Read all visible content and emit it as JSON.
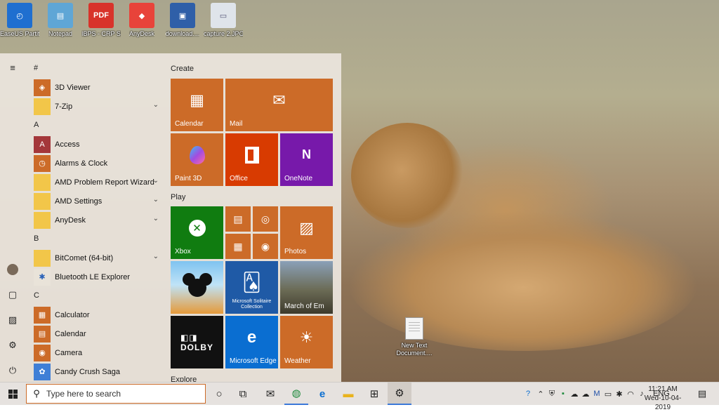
{
  "desktop": {
    "icons": [
      {
        "label": "EaseUS Partition ...",
        "color": "#1f6fd0",
        "glyph": "◴"
      },
      {
        "label": "Notepad",
        "color": "#5fa6d6",
        "glyph": "▤"
      },
      {
        "label": "IBPS - CRP SPL-VIII - R...",
        "color": "#d8332a",
        "glyph": "PDF"
      },
      {
        "label": "AnyDesk",
        "color": "#e8433a",
        "glyph": "◆"
      },
      {
        "label": "download....",
        "color": "#2f5fa8",
        "glyph": "▣"
      },
      {
        "label": "capture 2.JPG",
        "color": "#dfe4ea",
        "glyph": "▭"
      }
    ],
    "new_text_label": "New Text Document...."
  },
  "start_menu": {
    "rail": [
      {
        "name": "hamburger-menu-icon",
        "glyph": "≡"
      },
      {
        "name": "user-avatar-icon",
        "glyph": "●"
      },
      {
        "name": "documents-icon",
        "glyph": "▢"
      },
      {
        "name": "pictures-icon",
        "glyph": "▨"
      },
      {
        "name": "settings-icon",
        "glyph": "⚙"
      },
      {
        "name": "power-icon",
        "glyph": "⏻"
      }
    ],
    "apps": [
      {
        "type": "group",
        "label": "#"
      },
      {
        "type": "app",
        "label": "3D Viewer",
        "color": "#cc6b28",
        "glyph": "◈",
        "chevron": false
      },
      {
        "type": "app",
        "label": "7-Zip",
        "color": "#f2c649",
        "glyph": "",
        "chevron": true
      },
      {
        "type": "group",
        "label": "A"
      },
      {
        "type": "app",
        "label": "Access",
        "color": "#a4373a",
        "glyph": "A",
        "chevron": false
      },
      {
        "type": "app",
        "label": "Alarms & Clock",
        "color": "#cc6b28",
        "glyph": "◷",
        "chevron": false
      },
      {
        "type": "app",
        "label": "AMD Problem Report Wizard",
        "color": "#f2c649",
        "glyph": "",
        "chevron": true
      },
      {
        "type": "app",
        "label": "AMD Settings",
        "color": "#f2c649",
        "glyph": "",
        "chevron": true
      },
      {
        "type": "app",
        "label": "AnyDesk",
        "color": "#f2c649",
        "glyph": "",
        "chevron": true
      },
      {
        "type": "group",
        "label": "B"
      },
      {
        "type": "app",
        "label": "BitComet (64-bit)",
        "color": "#f2c649",
        "glyph": "",
        "chevron": true
      },
      {
        "type": "app",
        "label": "Bluetooth LE Explorer",
        "color": "#e9e3d9",
        "glyph": "✱",
        "chevron": false
      },
      {
        "type": "group",
        "label": "C"
      },
      {
        "type": "app",
        "label": "Calculator",
        "color": "#cc6b28",
        "glyph": "▦",
        "chevron": false
      },
      {
        "type": "app",
        "label": "Calendar",
        "color": "#cc6b28",
        "glyph": "▤",
        "chevron": false
      },
      {
        "type": "app",
        "label": "Camera",
        "color": "#cc6b28",
        "glyph": "◉",
        "chevron": false
      },
      {
        "type": "app",
        "label": "Candy Crush Saga",
        "color": "#3f7fd6",
        "glyph": "✿",
        "chevron": false
      }
    ],
    "sections": {
      "create": "Create",
      "play": "Play",
      "explore": "Explore"
    },
    "tiles": {
      "calendar": "Calendar",
      "mail": "Mail",
      "paint3d": "Paint 3D",
      "office": "Office",
      "onenote": "OneNote",
      "xbox": "Xbox",
      "photos": "Photos",
      "solitaire": "Microsoft Solitaire Collection",
      "march": "March of Em",
      "edge": "Microsoft Edge",
      "weather": "Weather"
    }
  },
  "taskbar": {
    "search_placeholder": "Type here to search",
    "language": "ENG",
    "time": "11:21 AM",
    "date": "Wed-10-04-2019"
  }
}
